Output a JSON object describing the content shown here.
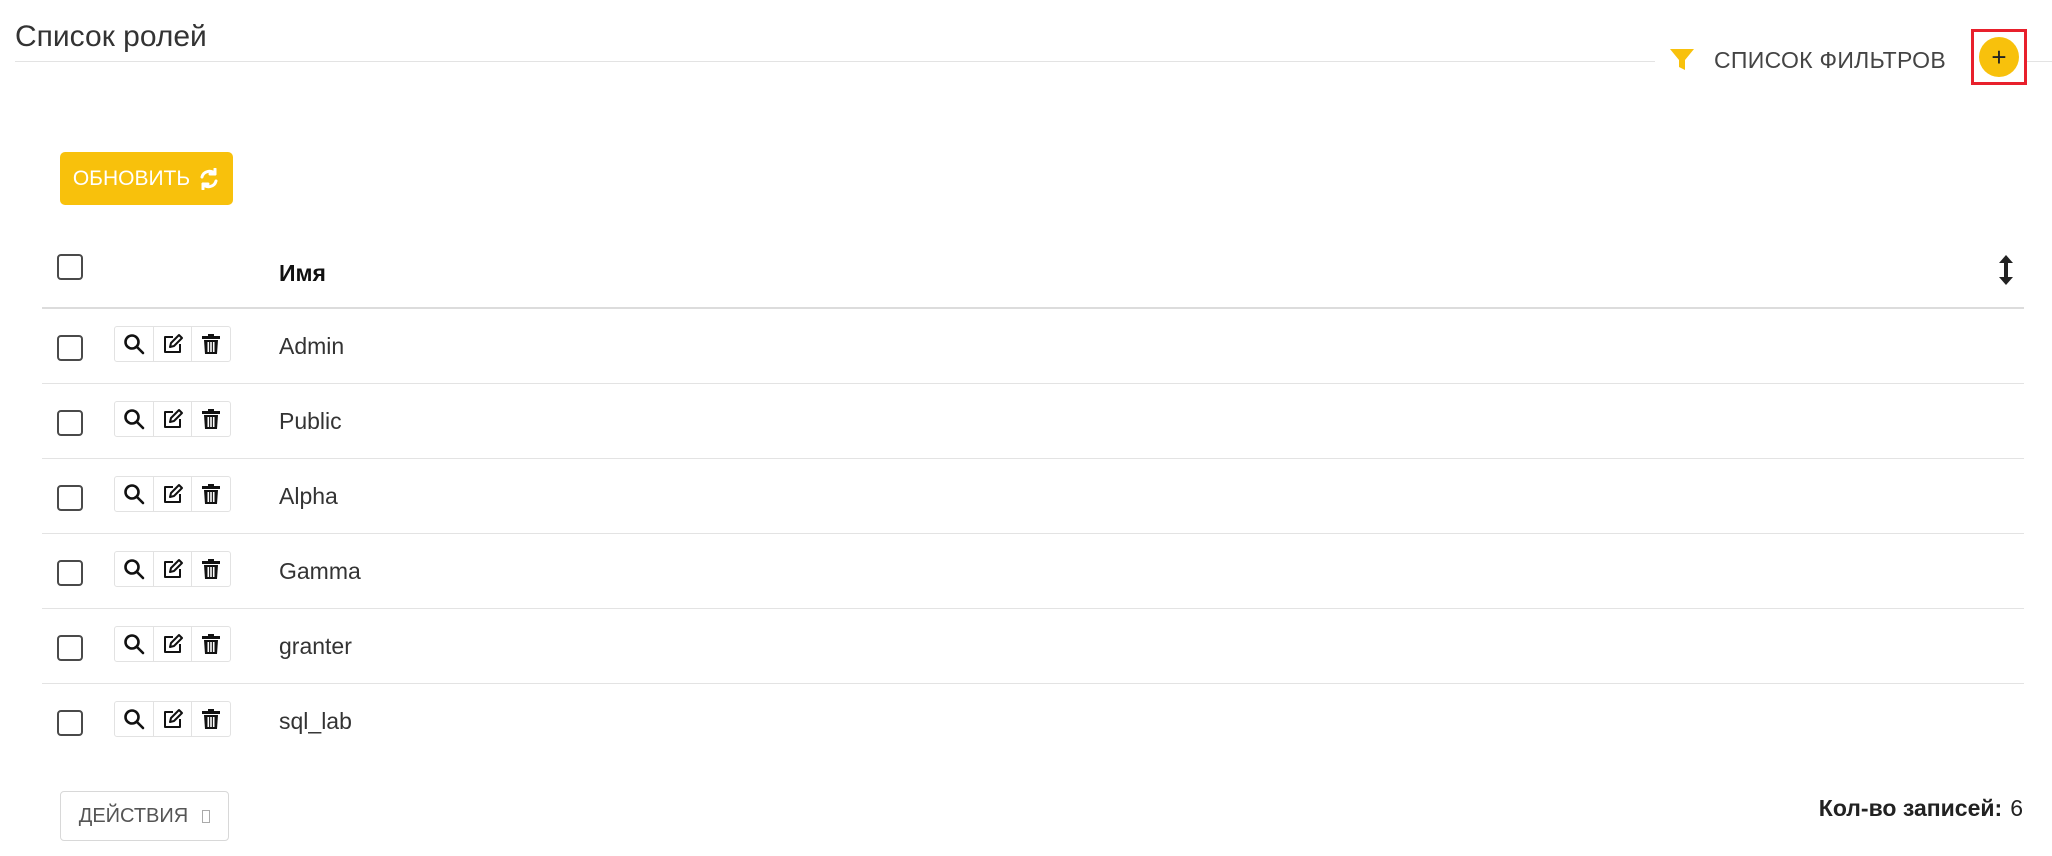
{
  "page": {
    "title": "Список ролей"
  },
  "filters": {
    "label": "СПИСОК ФИЛЬТРОВ",
    "add_label": "+"
  },
  "toolbar": {
    "refresh_label": "ОБНОВИТЬ"
  },
  "table": {
    "columns": [
      "Имя"
    ],
    "rows": [
      {
        "name": "Admin"
      },
      {
        "name": "Public"
      },
      {
        "name": "Alpha"
      },
      {
        "name": "Gamma"
      },
      {
        "name": "granter"
      },
      {
        "name": "sql_lab"
      }
    ]
  },
  "footer": {
    "actions_label": "ДЕЙСТВИЯ",
    "records_label": "Кол-во записей:",
    "records_count": "6"
  },
  "colors": {
    "accent": "#f8c10c",
    "highlight_border": "#e8202c"
  },
  "icons": {
    "filter": "filter-icon",
    "refresh": "refresh-icon",
    "sort": "sort-icon",
    "view": "search-icon",
    "edit": "edit-icon",
    "delete": "trash-icon"
  }
}
